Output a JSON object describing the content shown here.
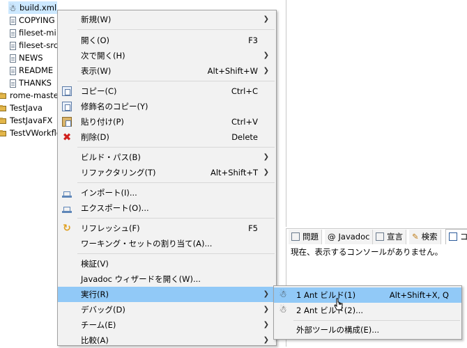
{
  "tree": {
    "items": [
      {
        "label": "build.xml",
        "icon": "ant-file-icon",
        "selected": true
      },
      {
        "label": "COPYING",
        "icon": "file-icon"
      },
      {
        "label": "fileset-mi",
        "icon": "file-icon"
      },
      {
        "label": "fileset-src",
        "icon": "file-icon"
      },
      {
        "label": "NEWS",
        "icon": "file-icon"
      },
      {
        "label": "README",
        "icon": "file-icon"
      },
      {
        "label": "THANKS",
        "icon": "file-icon"
      },
      {
        "label": "rome-master",
        "icon": "project-icon"
      },
      {
        "label": "TestJava",
        "icon": "project-icon"
      },
      {
        "label": "TestJavaFX",
        "icon": "project-icon"
      },
      {
        "label": "TestVWorkflo",
        "icon": "project-icon"
      }
    ]
  },
  "context_menu": {
    "items": [
      {
        "label": "新規(W)",
        "accel": "",
        "submenu": true
      },
      {
        "label": "開く(O)",
        "accel": "F3",
        "submenu": false
      },
      {
        "label": "次で開く(H)",
        "accel": "",
        "submenu": true
      },
      {
        "label": "表示(W)",
        "accel": "Alt+Shift+W",
        "submenu": true
      },
      {
        "label": "コピー(C)",
        "accel": "Ctrl+C",
        "submenu": false,
        "icon": "copy-icon"
      },
      {
        "label": "修飾名のコピー(Y)",
        "accel": "",
        "submenu": false,
        "icon": "copy-qualified-icon"
      },
      {
        "label": "貼り付け(P)",
        "accel": "Ctrl+V",
        "submenu": false,
        "icon": "paste-icon"
      },
      {
        "label": "削除(D)",
        "accel": "Delete",
        "submenu": false,
        "icon": "delete-icon"
      },
      {
        "label": "ビルド・パス(B)",
        "accel": "",
        "submenu": true
      },
      {
        "label": "リファクタリング(T)",
        "accel": "Alt+Shift+T",
        "submenu": true
      },
      {
        "label": "インポート(I)...",
        "accel": "",
        "submenu": false,
        "icon": "import-icon"
      },
      {
        "label": "エクスポート(O)...",
        "accel": "",
        "submenu": false,
        "icon": "export-icon"
      },
      {
        "label": "リフレッシュ(F)",
        "accel": "F5",
        "submenu": false,
        "icon": "refresh-icon"
      },
      {
        "label": "ワーキング・セットの割り当て(A)...",
        "accel": "",
        "submenu": false
      },
      {
        "label": "検証(V)",
        "accel": "",
        "submenu": false
      },
      {
        "label": "Javadoc ウィザードを開く(W)...",
        "accel": "",
        "submenu": false
      },
      {
        "label": "実行(R)",
        "accel": "",
        "submenu": true,
        "highlighted": true
      },
      {
        "label": "デバッグ(D)",
        "accel": "",
        "submenu": true
      },
      {
        "label": "チーム(E)",
        "accel": "",
        "submenu": true
      },
      {
        "label": "比較(A)",
        "accel": "",
        "submenu": true
      }
    ]
  },
  "run_submenu": {
    "items": [
      {
        "label": "1 Ant ビルド(1)",
        "accel": "Alt+Shift+X, Q",
        "icon": "ant-icon",
        "highlighted": true
      },
      {
        "label": "2 Ant ビルド(2)...",
        "accel": "",
        "icon": "ant-icon"
      },
      {
        "label": "外部ツールの構成(E)...",
        "accel": ""
      }
    ]
  },
  "views": {
    "tabs": [
      {
        "label": "問題",
        "icon": "problems-icon"
      },
      {
        "label": "Javadoc",
        "icon": "javadoc-icon"
      },
      {
        "label": "宣言",
        "icon": "declaration-icon"
      },
      {
        "label": "検索",
        "icon": "search-icon"
      },
      {
        "label": "コ",
        "icon": "console-icon",
        "active": true
      }
    ],
    "console_message": "現在、表示するコンソールがありません。"
  },
  "colors": {
    "menu_bg": "#f2f2f2",
    "menu_highlight": "#91c9f7",
    "tree_selection": "#cce8ff",
    "separator": "#d7d7d7"
  }
}
